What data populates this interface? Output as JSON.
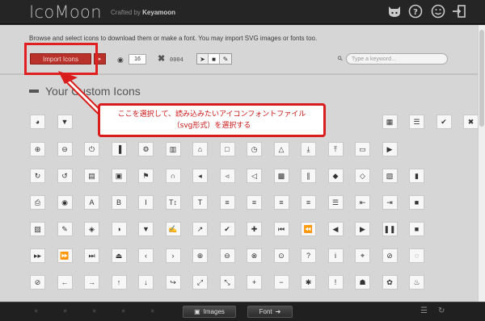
{
  "topbar": {
    "logo": "IcoMoon",
    "crafted_prefix": "Crafted by ",
    "crafted_author": "Keyamoon",
    "icons": [
      "github-icon",
      "help-icon",
      "smiley-icon",
      "exit-icon"
    ]
  },
  "toolbar": {
    "description": "Browse and select icons to download them or make a font. You may import SVG images or fonts too.",
    "import_label": "Import Icons",
    "library_label": "▸",
    "size_value": "16",
    "selected_count": "0004",
    "search_placeholder": "Type a keyword…"
  },
  "icon_set": {
    "title": "Your Custom Icons",
    "rows": [
      [
        "rss",
        "filter",
        "",
        "",
        "",
        "",
        "",
        "",
        "",
        "",
        "",
        "",
        "",
        "grid",
        "list",
        "check",
        "close"
      ],
      [
        "zoom-in",
        "zoom-out",
        "power",
        "signal",
        "gear",
        "trash",
        "home",
        "file",
        "time",
        "road",
        "download",
        "upload",
        "inbox",
        "play"
      ],
      [
        "repeat",
        "refresh",
        "list-alt",
        "lock",
        "flag",
        "headphones",
        "volume-off",
        "volume-down",
        "volume-up",
        "qrcode",
        "barcode",
        "tag",
        "tags",
        "book",
        "bookmark"
      ],
      [
        "print",
        "camera",
        "font",
        "bold",
        "italic",
        "text-height",
        "text-width",
        "align-left",
        "align-center",
        "align-right",
        "align-justify",
        "list",
        "indent-left",
        "indent-right",
        "facetime-video"
      ],
      [
        "picture",
        "pencil",
        "map-marker",
        "adjust",
        "tint",
        "edit",
        "share",
        "check",
        "move",
        "step-backward",
        "fast-backward",
        "backward",
        "play",
        "pause",
        "stop"
      ],
      [
        "forward",
        "fast-forward",
        "step-forward",
        "eject",
        "chevron-left",
        "chevron-right",
        "plus-sign",
        "minus-sign",
        "remove-sign",
        "ok-sign",
        "question-sign",
        "info-sign",
        "screenshot",
        "remove-circle",
        "ok-circle"
      ],
      [
        "ban-circle",
        "arrow-left",
        "arrow-right",
        "arrow-up",
        "arrow-down",
        "share-alt",
        "resize-full",
        "resize-small",
        "plus",
        "minus",
        "asterisk",
        "exclamation-sign",
        "gift",
        "leaf",
        "fire"
      ]
    ]
  },
  "annotation": {
    "line1": "ここを選択して、読み込みたいアイコンフォントファイル",
    "line2": "（svg形式）を選択する",
    "color": "#d91c1c"
  },
  "bottombar": {
    "images_label": "Images",
    "font_label": "Font"
  }
}
